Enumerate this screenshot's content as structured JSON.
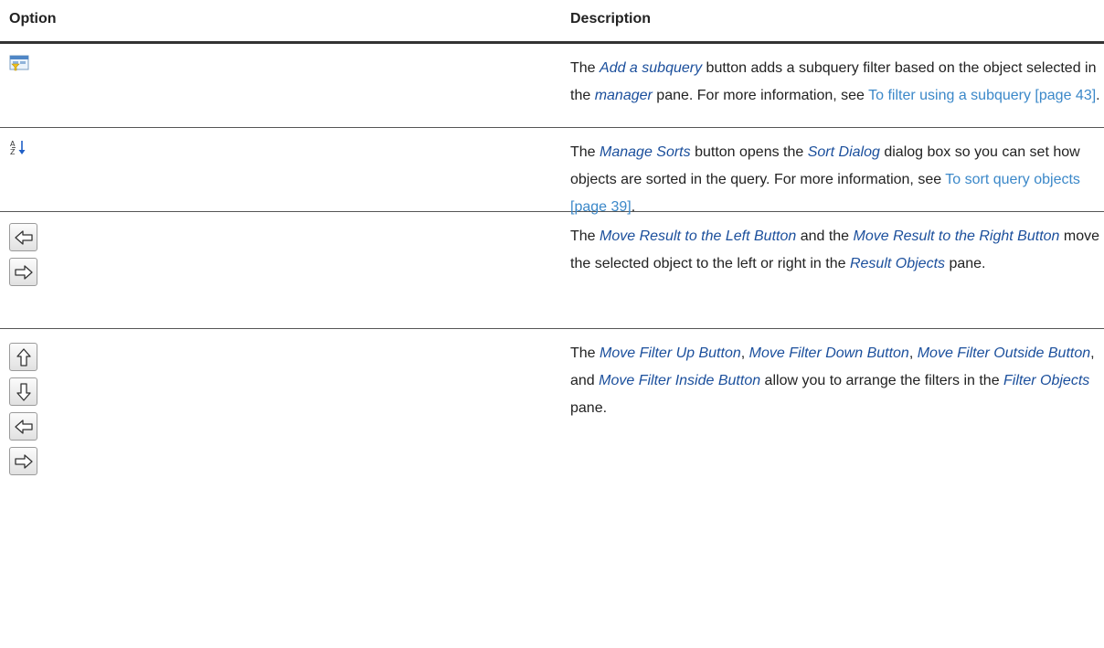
{
  "header": {
    "option_label": "Option",
    "description_label": "Description"
  },
  "rows": [
    {
      "icons": [
        "add-subquery-icon"
      ],
      "description": [
        {
          "text": "The ",
          "style": "plain"
        },
        {
          "text": "Add a subquery",
          "style": "em"
        },
        {
          "text": " button adds a subquery filter based on the object selected in the ",
          "style": "plain"
        },
        {
          "text": "manager",
          "style": "em"
        },
        {
          "text": " pane. For more information, see ",
          "style": "plain"
        },
        {
          "text": "To filter using a subquery [page 43]",
          "style": "link"
        },
        {
          "text": ".",
          "style": "plain"
        }
      ]
    },
    {
      "icons": [
        "sort-az-icon"
      ],
      "description": [
        {
          "text": "The ",
          "style": "plain"
        },
        {
          "text": "Manage Sorts",
          "style": "em"
        },
        {
          "text": " button opens the ",
          "style": "plain"
        },
        {
          "text": "Sort Dialog",
          "style": "em"
        },
        {
          "text": " dialog box so you can set how objects are sorted in the query. For more information, see ",
          "style": "plain"
        },
        {
          "text": "To sort query objects [page 39]",
          "style": "link"
        },
        {
          "text": ".",
          "style": "plain"
        }
      ]
    },
    {
      "icons": [
        "arrow-left-icon",
        "arrow-right-icon"
      ],
      "description": [
        {
          "text": "The ",
          "style": "plain"
        },
        {
          "text": "Move Result to the Left Button",
          "style": "em"
        },
        {
          "text": " and the ",
          "style": "plain"
        },
        {
          "text": "Move Result to the Right Button",
          "style": "em"
        },
        {
          "text": " move the selected object to the left or right in the ",
          "style": "plain"
        },
        {
          "text": "Result Objects",
          "style": "em"
        },
        {
          "text": " pane.",
          "style": "plain"
        }
      ]
    },
    {
      "icons": [
        "arrow-up-icon",
        "arrow-down-icon",
        "arrow-left-icon",
        "arrow-right-icon"
      ],
      "description": [
        {
          "text": "The ",
          "style": "plain"
        },
        {
          "text": "Move Filter Up Button",
          "style": "em"
        },
        {
          "text": ", ",
          "style": "plain"
        },
        {
          "text": "Move Filter Down Button",
          "style": "em"
        },
        {
          "text": ", ",
          "style": "plain"
        },
        {
          "text": "Move Filter Outside Button",
          "style": "em"
        },
        {
          "text": ", and ",
          "style": "plain"
        },
        {
          "text": "Move Filter Inside Button",
          "style": "em"
        },
        {
          "text": " allow you to arrange the filters in the ",
          "style": "plain"
        },
        {
          "text": "Filter Objects",
          "style": "em"
        },
        {
          "text": " pane.",
          "style": "plain"
        }
      ]
    }
  ],
  "colors": {
    "emphasis": "#1b4f9c",
    "link": "#3b88c9",
    "text": "#222222"
  }
}
